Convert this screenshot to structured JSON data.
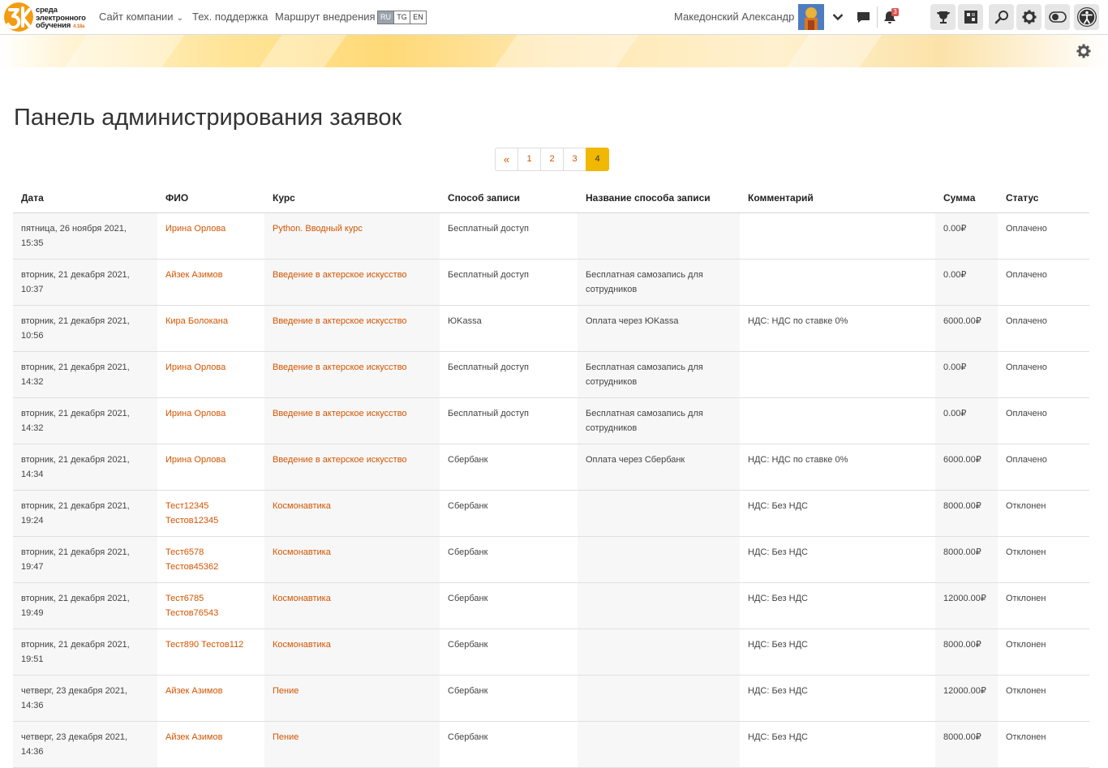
{
  "header": {
    "logo_line1": "среда",
    "logo_line2": "электронного",
    "logo_line3": "обучения",
    "logo_version": "4.18a",
    "logo_mark": "3k-logo",
    "nav_company": "Сайт компании",
    "nav_support": "Тех. поддержка",
    "nav_route": "Маршрут внедрения",
    "languages": [
      "RU",
      "TG",
      "EN"
    ],
    "active_language": "RU",
    "user_name": "Македонский Александр",
    "notification_count": "3",
    "icons": [
      "chevron-down-icon",
      "chat-icon",
      "bell-icon",
      "trophy-icon",
      "puzzle-icon",
      "search-icon",
      "gear-icon",
      "toggle-icon",
      "accessibility-icon"
    ]
  },
  "page": {
    "title": "Панель администрирования заявок"
  },
  "pagination": {
    "prev": "«",
    "pages": [
      "1",
      "2",
      "3",
      "4"
    ],
    "current": "4"
  },
  "table": {
    "columns": [
      "Дата",
      "ФИО",
      "Курс",
      "Способ записи",
      "Название способа записи",
      "Комментарий",
      "Сумма",
      "Статус"
    ],
    "rows": [
      {
        "date": "пятница, 26 ноября 2021, 15:35",
        "name": "Ирина Орлова",
        "course": "Python. Вводный курс",
        "method": "Бесплатный доступ",
        "method_name": "",
        "comment": "",
        "sum": "0.00₽",
        "status": "Оплачено"
      },
      {
        "date": "вторник, 21 декабря 2021, 10:37",
        "name": "Айзек Азимов",
        "course": "Введение в актерское искусство",
        "method": "Бесплатный доступ",
        "method_name": "Бесплатная самозапись для сотрудников",
        "comment": "",
        "sum": "0.00₽",
        "status": "Оплачено"
      },
      {
        "date": "вторник, 21 декабря 2021, 10:56",
        "name": "Кира Болокана",
        "course": "Введение в актерское искусство",
        "method": "ЮKassa",
        "method_name": "Оплата через ЮKassa",
        "comment": "НДС: НДС по ставке 0%",
        "sum": "6000.00₽",
        "status": "Оплачено"
      },
      {
        "date": "вторник, 21 декабря 2021, 14:32",
        "name": "Ирина Орлова",
        "course": "Введение в актерское искусство",
        "method": "Бесплатный доступ",
        "method_name": "Бесплатная самозапись для сотрудников",
        "comment": "",
        "sum": "0.00₽",
        "status": "Оплачено"
      },
      {
        "date": "вторник, 21 декабря 2021, 14:32",
        "name": "Ирина Орлова",
        "course": "Введение в актерское искусство",
        "method": "Бесплатный доступ",
        "method_name": "Бесплатная самозапись для сотрудников",
        "comment": "",
        "sum": "0.00₽",
        "status": "Оплачено"
      },
      {
        "date": "вторник, 21 декабря 2021, 14:34",
        "name": "Ирина Орлова",
        "course": "Введение в актерское искусство",
        "method": "Сбербанк",
        "method_name": "Оплата через Сбербанк",
        "comment": "НДС: НДС по ставке 0%",
        "sum": "6000.00₽",
        "status": "Оплачено"
      },
      {
        "date": "вторник, 21 декабря 2021, 19:24",
        "name": "Тест12345 Тестов12345",
        "course": "Космонавтика",
        "method": "Сбербанк",
        "method_name": "",
        "comment": "НДС: Без НДС",
        "sum": "8000.00₽",
        "status": "Отклонен"
      },
      {
        "date": "вторник, 21 декабря 2021, 19:47",
        "name": "Тест6578 Тестов45362",
        "course": "Космонавтика",
        "method": "Сбербанк",
        "method_name": "",
        "comment": "НДС: Без НДС",
        "sum": "8000.00₽",
        "status": "Отклонен"
      },
      {
        "date": "вторник, 21 декабря 2021, 19:49",
        "name": "Тест6785 Тестов76543",
        "course": "Космонавтика",
        "method": "Сбербанк",
        "method_name": "",
        "comment": "НДС: Без НДС",
        "sum": "12000.00₽",
        "status": "Отклонен"
      },
      {
        "date": "вторник, 21 декабря 2021, 19:51",
        "name": "Тест890 Тестов112",
        "course": "Космонавтика",
        "method": "Сбербанк",
        "method_name": "",
        "comment": "НДС: Без НДС",
        "sum": "8000.00₽",
        "status": "Отклонен"
      },
      {
        "date": "четверг, 23 декабря 2021, 14:36",
        "name": "Айзек Азимов",
        "course": "Пение",
        "method": "Сбербанк",
        "method_name": "",
        "comment": "НДС: Без НДС",
        "sum": "12000.00₽",
        "status": "Отклонен"
      },
      {
        "date": "четверг, 23 декабря 2021, 14:36",
        "name": "Айзек Азимов",
        "course": "Пение",
        "method": "Сбербанк",
        "method_name": "",
        "comment": "НДС: Без НДС",
        "sum": "8000.00₽",
        "status": "Отклонен"
      }
    ]
  },
  "colors": {
    "link": "#d35400",
    "active_page": "#f0b800",
    "row_shade": "#f7f7f7",
    "badge": "#d9534f"
  }
}
